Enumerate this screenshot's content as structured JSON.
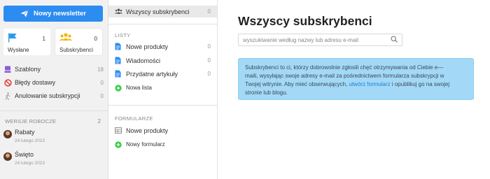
{
  "sidebar": {
    "new_button": "Nowy newsletter",
    "tiles": [
      {
        "label": "Wysłane",
        "count": "1",
        "icon": "flag-icon",
        "color": "#2b9be8"
      },
      {
        "label": "Subskrybenci",
        "count": "0",
        "icon": "people-icon",
        "color": "#f5b400"
      }
    ],
    "items": [
      {
        "label": "Szablony",
        "count": "18",
        "icon": "template-icon",
        "color": "#8a5cd6"
      },
      {
        "label": "Błędy dostawy",
        "count": "0",
        "icon": "block-icon",
        "color": "#e53935"
      },
      {
        "label": "Anulowanie subskrypcji",
        "count": "0",
        "icon": "walk-icon",
        "color": "#999999"
      }
    ],
    "drafts_header": "WERSJE ROBOCZE",
    "drafts_count": "2",
    "drafts": [
      {
        "title": "Rabaty",
        "date": "24 lutego 2023"
      },
      {
        "title": "Święto",
        "date": "24 lutego 2023"
      }
    ]
  },
  "middle": {
    "all": {
      "label": "Wszyscy subskrybenci",
      "count": "0"
    },
    "lists_header": "LISTY",
    "lists": [
      {
        "label": "Nowe produkty",
        "count": "0"
      },
      {
        "label": "Wiadomości",
        "count": "0"
      },
      {
        "label": "Przydatne artykuły",
        "count": "0"
      }
    ],
    "new_list": "Nowa lista",
    "forms_header": "FORMULARZE",
    "forms": [
      {
        "label": "Nowe produkty"
      }
    ],
    "new_form": "Nowy formularz"
  },
  "main": {
    "title": "Wszyscy subskrybenci",
    "search_placeholder": "wyszukiwanie według nazwy lub adresu e-mail",
    "info_line1": "Subskrybenci to ci, którzy dobrowolnie zgłosili chęć otrzymywania od Ciebie e—",
    "info_line2": "maili, wysyłając swoje adresy e-mail za pośrednictwem formularza subskrypcji w",
    "info_line3_a": "Twojej witrynie. Aby mieć obserwujących, ",
    "info_link": "utwórz formularz",
    "info_line3_b": " i opublikuj go na swojej",
    "info_line4": "stronie lub blogu.",
    "accent": "#2d8cf0",
    "info_bg": "#a3d9f7"
  }
}
